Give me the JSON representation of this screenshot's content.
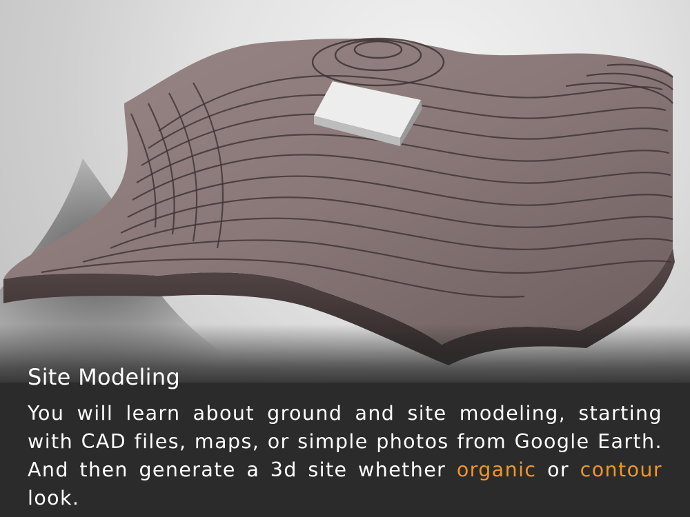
{
  "image": {
    "subject": "3d-topographic-site-model",
    "colors": {
      "background": "#d8d8d8",
      "terrain_top": "#8b7b7b",
      "terrain_edge": "#4a3d3d",
      "building": "#e9e9e9",
      "caption_background": "#2b2b2b",
      "caption_text": "#ffffff",
      "accent": "#f0962a"
    }
  },
  "caption": {
    "title": "Site Modeling",
    "body": {
      "part1": "You will learn about ground and site modeling, starting with CAD files, maps, or simple photos from Google Earth. And then generate a 3d site whether ",
      "highlight1": "organic",
      "part2": " or ",
      "highlight2": "contour",
      "part3": " look."
    }
  }
}
